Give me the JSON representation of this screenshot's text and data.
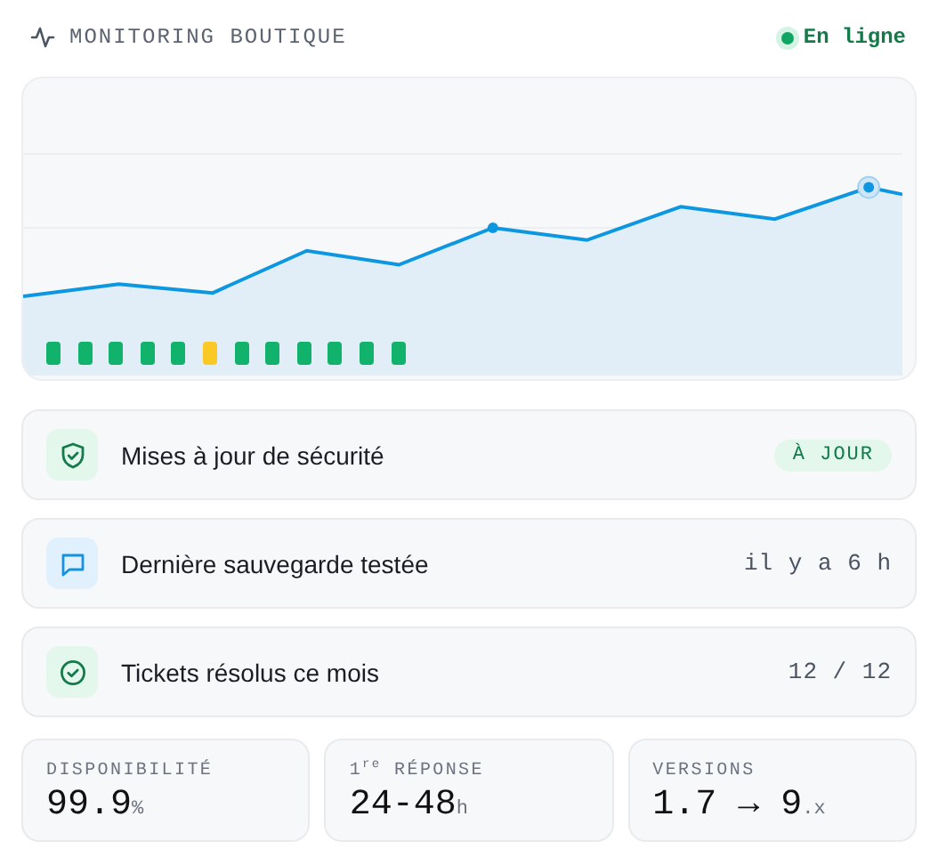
{
  "header": {
    "title": "MONITORING BOUTIQUE",
    "status": {
      "label": "En ligne",
      "online": true
    }
  },
  "chart": {
    "kind": "picture",
    "status_bars": [
      {
        "color": "#10b26c"
      },
      {
        "color": "#10b26c"
      },
      {
        "color": "#10b26c"
      },
      {
        "color": "#10b26c"
      },
      {
        "color": "#10b26c"
      },
      {
        "color": "#fbc926"
      },
      {
        "color": "#10b26c"
      },
      {
        "color": "#10b26c"
      },
      {
        "color": "#10b26c"
      },
      {
        "color": "#10b26c"
      },
      {
        "color": "#10b26c"
      },
      {
        "color": "#10b26c"
      }
    ]
  },
  "rows": [
    {
      "label": "Mises à jour de sécurité",
      "kind": "badge",
      "value": "À JOUR"
    },
    {
      "label": "Dernière sauvegarde testée",
      "kind": "text",
      "value": "il y a 6 h"
    },
    {
      "label": "Tickets résolus ce mois",
      "kind": "text",
      "value": "12 / 12"
    }
  ],
  "stats": [
    {
      "label": "DISPONIBILITÉ",
      "value": "99.9",
      "unit": "%"
    },
    {
      "label": "1$^{re}$ RÉPONSE",
      "value": "24-48",
      "unit": "h"
    },
    {
      "label": "VERSIONS",
      "value": "1.7 → 9",
      "unit": ".x"
    }
  ]
}
